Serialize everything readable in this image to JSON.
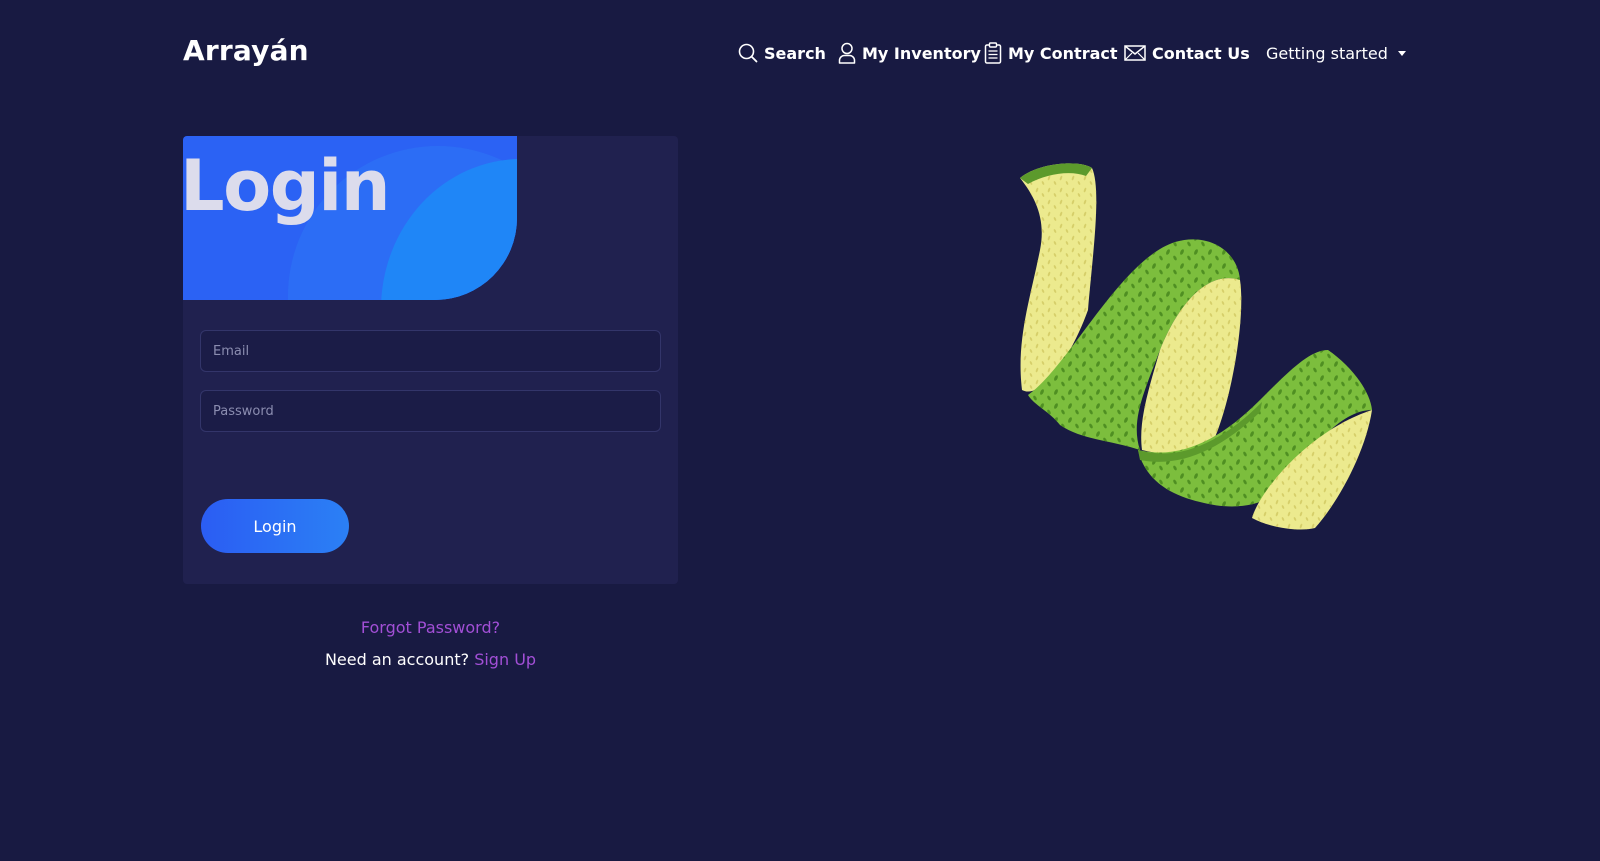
{
  "app": {
    "brand": "Arrayán"
  },
  "nav": {
    "search": {
      "label": "Search",
      "icon": "search-icon"
    },
    "inventory": {
      "label": "My Inventory",
      "icon": "user-icon"
    },
    "contract": {
      "label": "My Contract",
      "icon": "clipboard-icon"
    },
    "contact": {
      "label": "Contact Us",
      "icon": "envelope-icon"
    },
    "getting_started": {
      "label": "Getting started",
      "icon": "caret-down-icon"
    }
  },
  "login_card": {
    "title": "Login",
    "email_placeholder": "Email",
    "email_value": "",
    "password_placeholder": "Password",
    "password_value": "",
    "submit_label": "Login"
  },
  "links": {
    "forgot_password": "Forgot Password?",
    "need_account": "Need an account?",
    "sign_up": "Sign Up"
  },
  "illustration": {
    "icon": "lime-peel-illustration"
  },
  "colors": {
    "background": "#181a42",
    "card": "#20214f",
    "accent_blue": "#2b62f4",
    "link_purple": "#a24fd6",
    "peel_green": "#7cbe3d",
    "peel_yellow": "#ecea8e"
  }
}
